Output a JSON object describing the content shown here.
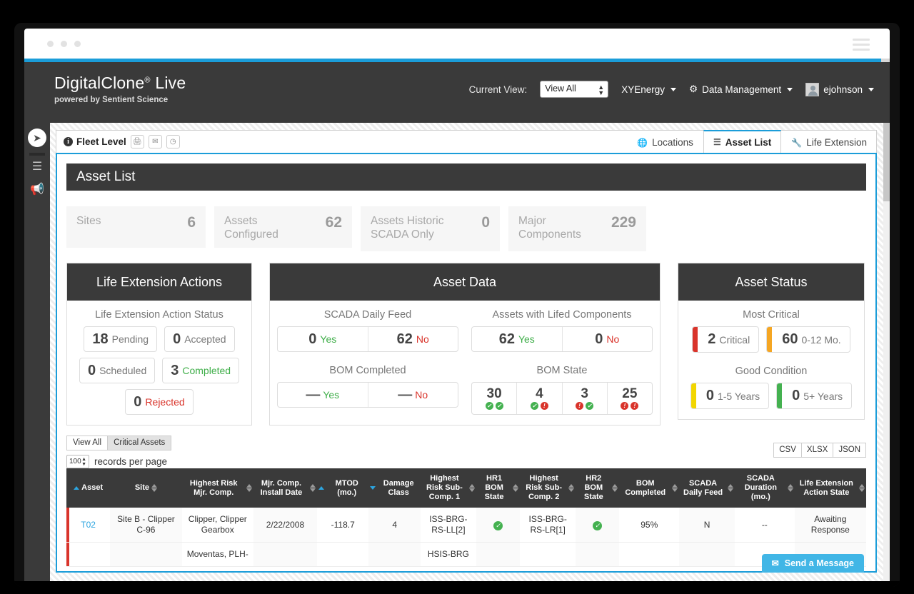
{
  "chrome": {
    "menu_icon": "hamburger-icon"
  },
  "header": {
    "brand_title": "DigitalClone",
    "brand_reg": "®",
    "brand_title_suffix": " Live",
    "brand_sub": "powered by Sentient Science",
    "current_view_label": "Current View:",
    "current_view_value": "View All",
    "org_menu": "XYEnergy",
    "data_management": "Data Management",
    "user": "ejohnson"
  },
  "rail": {
    "toggle_icon": "arrow-right-icon",
    "list_icon": "list-icon",
    "announce_icon": "megaphone-icon"
  },
  "panel": {
    "fleet_title": "Fleet Level",
    "mini_buttons": [
      "print-icon",
      "mail-icon",
      "clock-icon"
    ],
    "tabs": [
      {
        "label": "Locations",
        "icon": "globe-icon",
        "active": false
      },
      {
        "label": "Asset List",
        "icon": "list-icon",
        "active": true
      },
      {
        "label": "Life Extension",
        "icon": "wrench-icon",
        "active": false
      }
    ],
    "section_title": "Asset List"
  },
  "stats": [
    {
      "label": "Sites",
      "value": "6"
    },
    {
      "label": "Assets Configured",
      "value": "62"
    },
    {
      "label": "Assets Historic SCADA Only",
      "value": "0"
    },
    {
      "label": "Major Components",
      "value": "229"
    }
  ],
  "life_extension": {
    "title": "Life Extension Actions",
    "group_label": "Life Extension Action Status",
    "items": [
      {
        "value": "18",
        "label": "Pending",
        "color": "gray"
      },
      {
        "value": "0",
        "label": "Accepted",
        "color": "gray"
      },
      {
        "value": "0",
        "label": "Scheduled",
        "color": "gray"
      },
      {
        "value": "3",
        "label": "Completed",
        "color": "green"
      },
      {
        "value": "0",
        "label": "Rejected",
        "color": "red"
      }
    ]
  },
  "asset_data": {
    "title": "Asset Data",
    "scada_daily_feed": {
      "label": "SCADA Daily Feed",
      "yes_value": "0",
      "yes_label": "Yes",
      "no_value": "62",
      "no_label": "No"
    },
    "lifed_components": {
      "label": "Assets with Lifed Components",
      "yes_value": "62",
      "yes_label": "Yes",
      "no_value": "0",
      "no_label": "No"
    },
    "bom_completed": {
      "label": "BOM Completed",
      "yes_value": "—",
      "yes_label": "Yes",
      "no_value": "—",
      "no_label": "No"
    },
    "bom_state": {
      "label": "BOM State",
      "cells": [
        {
          "value": "30",
          "badges": [
            "ok",
            "ok"
          ]
        },
        {
          "value": "4",
          "badges": [
            "ok",
            "bad"
          ]
        },
        {
          "value": "3",
          "badges": [
            "bad",
            "ok"
          ]
        },
        {
          "value": "25",
          "badges": [
            "bad",
            "bad"
          ]
        }
      ]
    }
  },
  "asset_status": {
    "title": "Asset Status",
    "most_critical_label": "Most Critical",
    "good_condition_label": "Good Condition",
    "most_critical": [
      {
        "value": "2",
        "label": "Critical",
        "color": "#d9342b"
      },
      {
        "value": "60",
        "label": "0-12 Mo.",
        "color": "#f5a623"
      }
    ],
    "good_condition": [
      {
        "value": "0",
        "label": "1-5 Years",
        "color": "#f2d600"
      },
      {
        "value": "0",
        "label": "5+ Years",
        "color": "#44b150"
      }
    ]
  },
  "controls": {
    "view_all": "View All",
    "critical_assets": "Critical Assets",
    "records_value": "100",
    "records_label": "records per page",
    "exports": [
      "CSV",
      "XLSX",
      "JSON"
    ]
  },
  "table": {
    "columns": [
      {
        "label": "Asset",
        "sort": "up"
      },
      {
        "label": "Site",
        "sort": "both"
      },
      {
        "label": "Highest Risk Mjr. Comp.",
        "sort": "both"
      },
      {
        "label": "Mjr. Comp. Install Date",
        "sort": "both"
      },
      {
        "label": "MTOD (mo.)",
        "sort": "up"
      },
      {
        "label": "Damage Class",
        "sort": "down"
      },
      {
        "label": "Highest Risk Sub-Comp. 1",
        "sort": "both"
      },
      {
        "label": "HR1 BOM State",
        "sort": "both"
      },
      {
        "label": "Highest Risk Sub-Comp. 2",
        "sort": "both"
      },
      {
        "label": "HR2 BOM State",
        "sort": "both"
      },
      {
        "label": "BOM Completed",
        "sort": "both"
      },
      {
        "label": "SCADA Daily Feed",
        "sort": "both"
      },
      {
        "label": "SCADA Duration (mo.)",
        "sort": "both"
      },
      {
        "label": "Life Extension Action State",
        "sort": "both"
      }
    ],
    "rows": [
      {
        "asset": "T02",
        "site": "Site B - Clipper C-96",
        "highest_risk_mjr_comp": "Clipper, Clipper Gearbox",
        "install_date": "2/22/2008",
        "mtod": "-118.7",
        "damage_class": "4",
        "hr_sub_comp_1": "ISS-BRG-RS-LL[2]",
        "hr1_bom_state": "check",
        "hr_sub_comp_2": "ISS-BRG-RS-LR[1]",
        "hr2_bom_state": "check",
        "bom_completed": "95%",
        "scada_daily_feed": "N",
        "scada_duration": "--",
        "life_extension_action_state": "Awaiting Response"
      },
      {
        "asset": "",
        "site": "",
        "highest_risk_mjr_comp": "Moventas, PLH-",
        "install_date": "",
        "mtod": "",
        "damage_class": "",
        "hr_sub_comp_1": "HSIS-BRG",
        "hr1_bom_state": "",
        "hr_sub_comp_2": "",
        "hr2_bom_state": "",
        "bom_completed": "",
        "scada_daily_feed": "",
        "scada_duration": "",
        "life_extension_action_state": ""
      }
    ]
  },
  "message_button": {
    "label": "Send a Message",
    "icon": "envelope-icon"
  }
}
